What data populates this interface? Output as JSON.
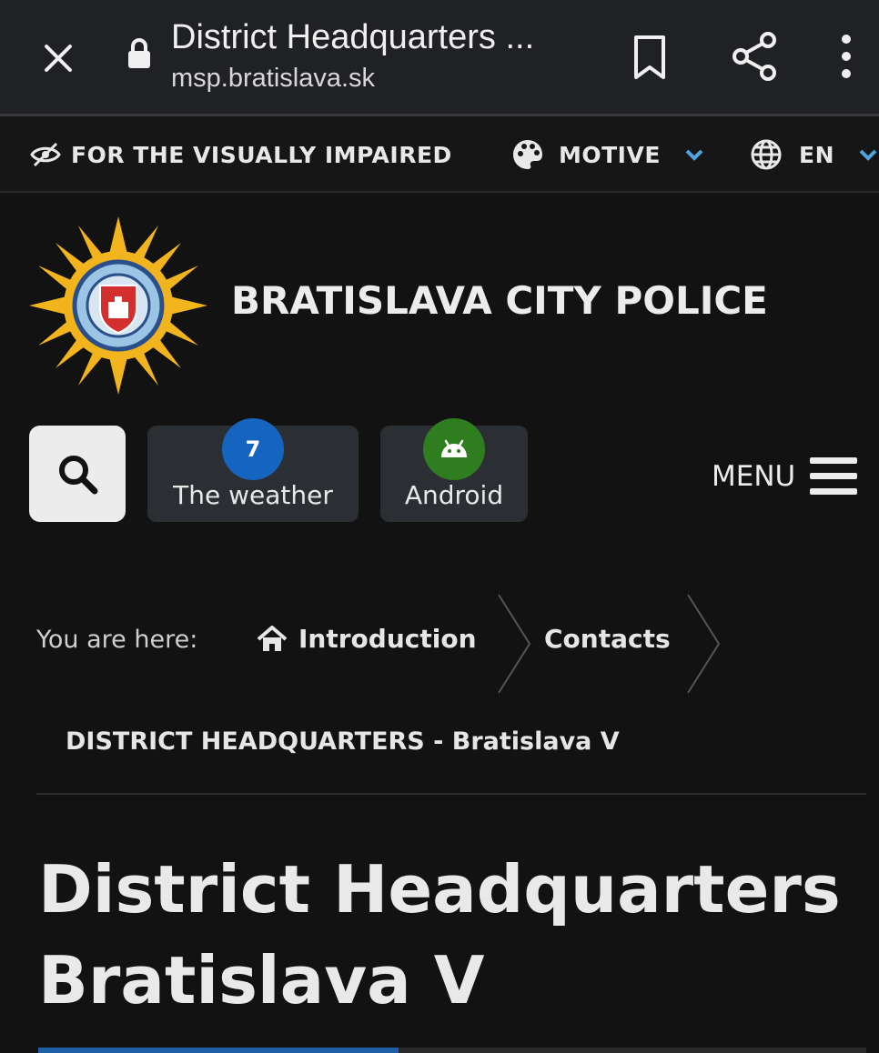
{
  "browser": {
    "page_title": "District Headquarters ...",
    "url": "msp.bratislava.sk",
    "icons": [
      "close-icon",
      "lock-icon",
      "bookmark-icon",
      "share-icon",
      "more-vert-icon"
    ]
  },
  "utility_bar": {
    "visually_impaired_label": "FOR THE VISUALLY IMPAIRED",
    "motive_label": "MOTIVE",
    "language_label": "EN",
    "icons": [
      "eye-slash-icon",
      "palette-icon",
      "globe-icon",
      "chevron-down-icon"
    ],
    "chevron_color": "#4fa3e0"
  },
  "header": {
    "site_title": "BRATISLAVA CITY POLICE",
    "logo": "city-police-star-badge",
    "logo_color": "#f2b41c"
  },
  "toolbar": {
    "weather": {
      "badge": "7",
      "label": "The weather",
      "badge_color": "#1565c0"
    },
    "android": {
      "label": "Android",
      "badge_color": "#2e7d1f"
    },
    "menu_label": "MENU",
    "icons": [
      "search-icon",
      "android-icon",
      "hamburger-icon"
    ]
  },
  "breadcrumb": {
    "label": "You are here:",
    "items": [
      {
        "label": "Introduction",
        "icon": "home-icon"
      },
      {
        "label": "Contacts"
      }
    ],
    "current": "DISTRICT HEADQUARTERS - Bratislava V"
  },
  "page": {
    "title_line1": "District Headquarters",
    "title_line2": "Bratislava V"
  }
}
